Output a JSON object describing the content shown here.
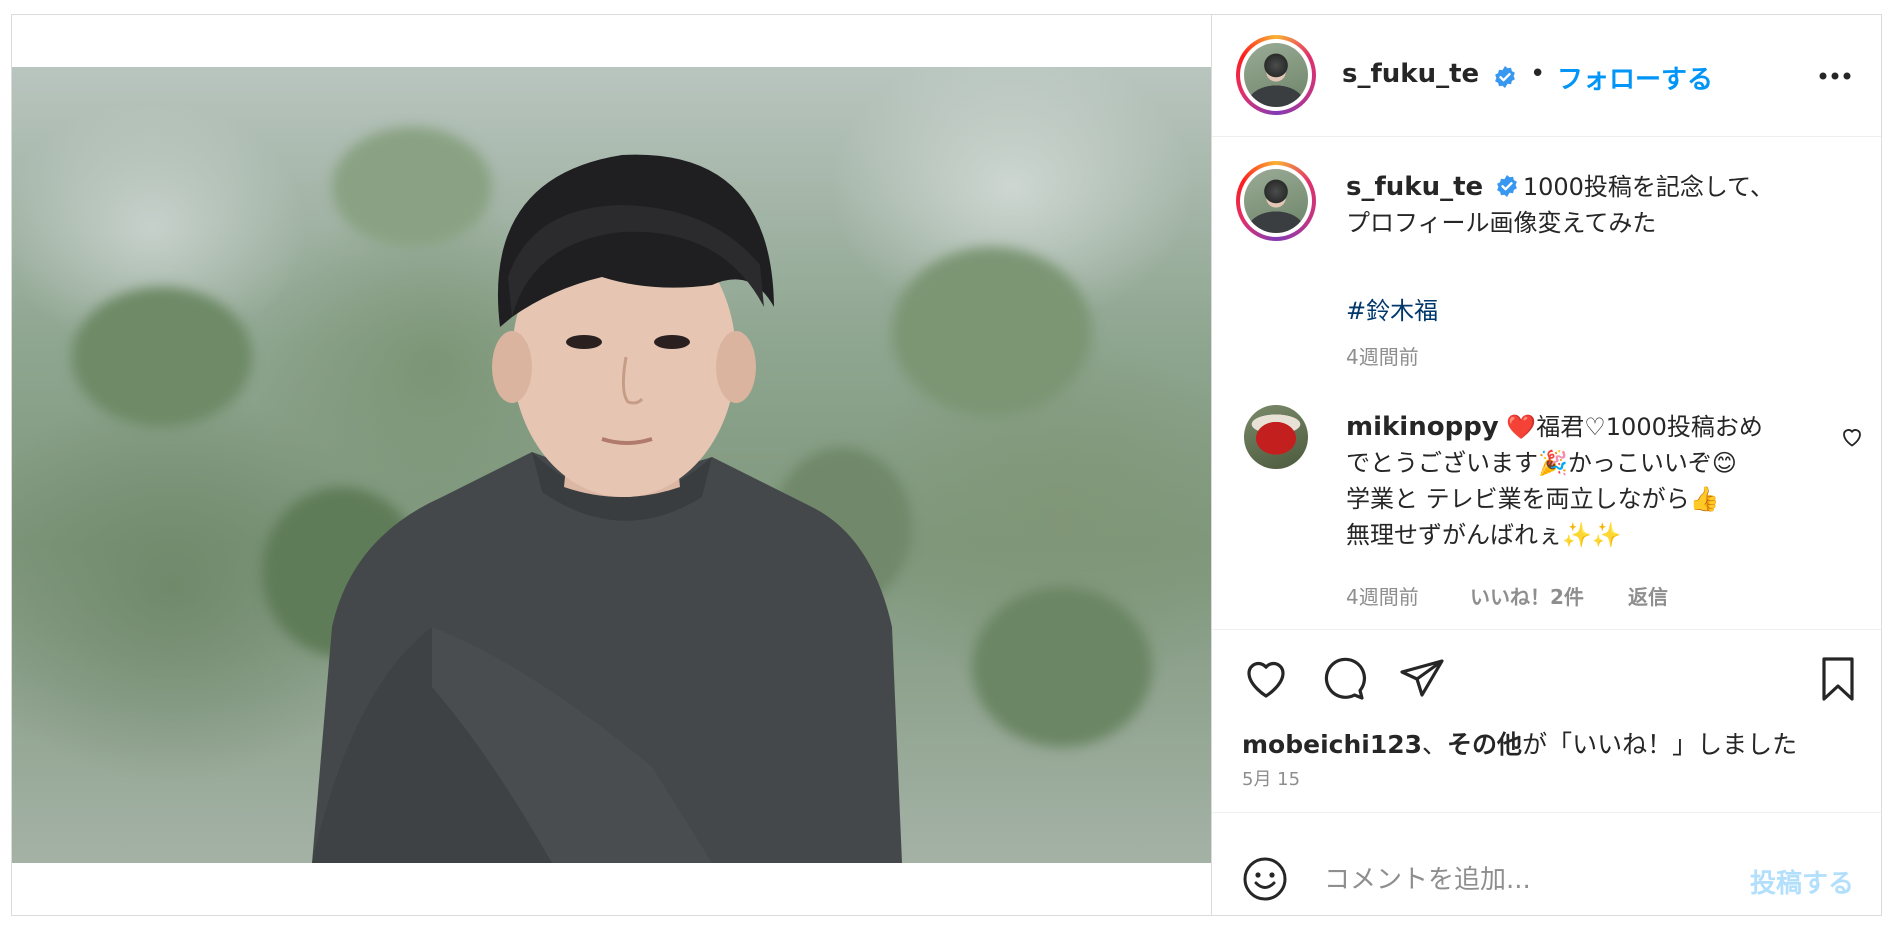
{
  "post": {
    "author": "s_fuku_te",
    "dot": "•",
    "follow_label": "フォローする",
    "verified_color": "#3897f0",
    "follow_color": "#0095f6"
  },
  "caption": {
    "author": "s_fuku_te",
    "text_line1": "1000投稿を記念して、",
    "text_line2": "プロフィール画像変えてみた",
    "hashtag": "#鈴木福",
    "time": "4週間前"
  },
  "comments": [
    {
      "author": "mikinoppy",
      "line1": "❤️福君♡1000投稿おめ",
      "line2": "でとうございます🎉かっこいいぞ😊",
      "line3": "学業と テレビ業を両立しながら👍",
      "line4": "無理せずがんばれぇ✨✨",
      "time": "4週間前",
      "likes": "いいね！2件",
      "reply": "返信"
    }
  ],
  "likes": {
    "user": "mobeichi123",
    "sep": "、",
    "others": "その他",
    "suffix": "が「いいね！」しました"
  },
  "date": "5月 15",
  "add_comment": {
    "placeholder": "コメントを追加...",
    "post_label": "投稿する"
  },
  "icons": {
    "more": "more-options-icon",
    "like": "heart-icon",
    "comment": "comment-icon",
    "share": "share-icon",
    "save": "bookmark-icon",
    "emoji": "emoji-icon"
  }
}
